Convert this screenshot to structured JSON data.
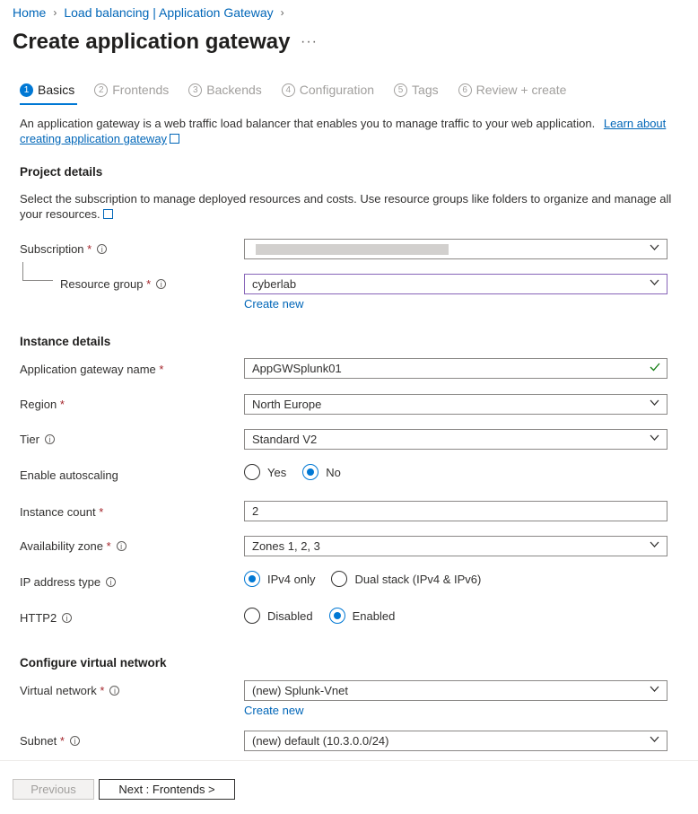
{
  "breadcrumb": {
    "items": [
      "Home",
      "Load balancing | Application Gateway"
    ]
  },
  "page": {
    "title": "Create application gateway",
    "more": "···"
  },
  "steps": [
    {
      "num": "1",
      "label": "Basics"
    },
    {
      "num": "2",
      "label": "Frontends"
    },
    {
      "num": "3",
      "label": "Backends"
    },
    {
      "num": "4",
      "label": "Configuration"
    },
    {
      "num": "5",
      "label": "Tags"
    },
    {
      "num": "6",
      "label": "Review + create"
    }
  ],
  "intro": {
    "text": "An application gateway is a web traffic load balancer that enables you to manage traffic to your web application.",
    "link1": "Learn about",
    "link2": "creating application gateway"
  },
  "project": {
    "heading": "Project details",
    "desc": "Select the subscription to manage deployed resources and costs. Use resource groups like folders to organize and manage all your resources.",
    "subscription_label": "Subscription",
    "resource_group_label": "Resource group",
    "resource_group_value": "cyberlab",
    "create_new": "Create new"
  },
  "instance": {
    "heading": "Instance details",
    "name_label": "Application gateway name",
    "name_value": "AppGWSplunk01",
    "region_label": "Region",
    "region_value": "North Europe",
    "tier_label": "Tier",
    "tier_value": "Standard V2",
    "autoscale_label": "Enable autoscaling",
    "autoscale_yes": "Yes",
    "autoscale_no": "No",
    "count_label": "Instance count",
    "count_value": "2",
    "zone_label": "Availability zone",
    "zone_value": "Zones 1, 2, 3",
    "ip_label": "IP address type",
    "ip_opt1": "IPv4 only",
    "ip_opt2": "Dual stack (IPv4 & IPv6)",
    "http2_label": "HTTP2",
    "http2_opt1": "Disabled",
    "http2_opt2": "Enabled"
  },
  "vnet": {
    "heading": "Configure virtual network",
    "vnet_label": "Virtual network",
    "vnet_value": "(new) Splunk-Vnet",
    "create_new": "Create new",
    "subnet_label": "Subnet",
    "subnet_value": "(new) default (10.3.0.0/24)"
  },
  "footer": {
    "previous": "Previous",
    "next": "Next : Frontends >"
  },
  "colors": {
    "accent": "#0078d4",
    "required": "#a4262c",
    "success": "#107c10"
  }
}
